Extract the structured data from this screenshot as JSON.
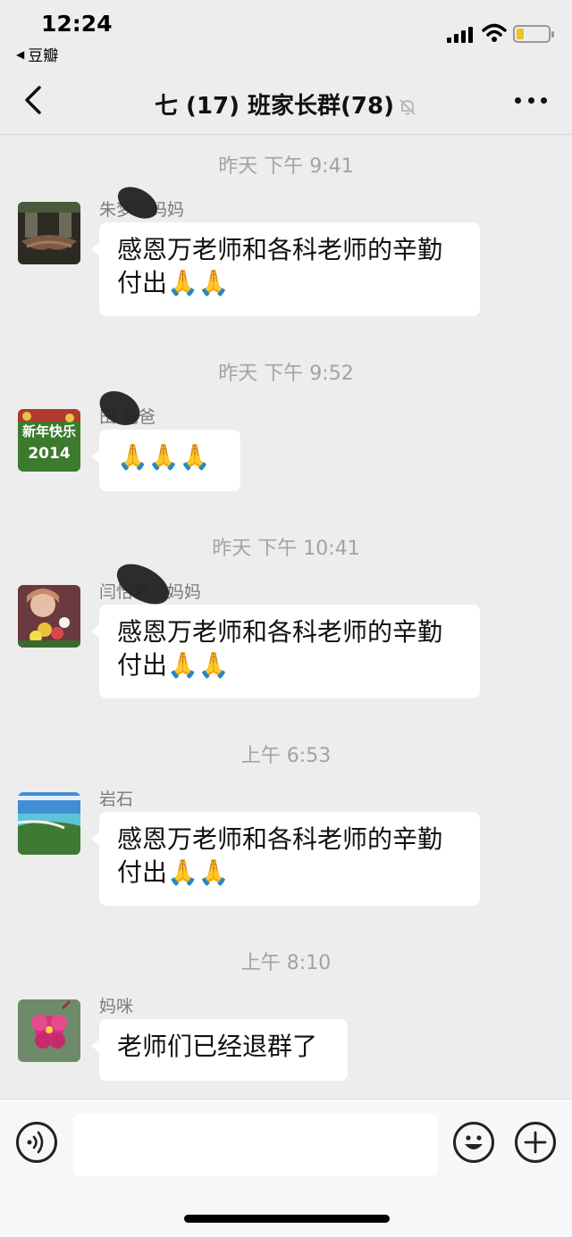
{
  "status_bar": {
    "time": "12:24",
    "back_app": "豆瓣"
  },
  "nav": {
    "title": "七 (17) 班家长群(78)",
    "icons": [
      "back-chevron-icon",
      "mute-bell-icon",
      "more-dots-icon"
    ]
  },
  "messages": [
    {
      "timestamp": "昨天 下午 9:41",
      "sender": "朱梦琪妈妈",
      "text": "感恩万老师和各科老师的辛勤付出🙏🙏"
    },
    {
      "timestamp": "昨天 下午 9:52",
      "sender": "田  爸爸",
      "text": "🙏🙏🙏",
      "avatar_text": "新年快乐2014"
    },
    {
      "timestamp": "昨天 下午 10:41",
      "sender": "闫怡君的妈妈",
      "text": "感恩万老师和各科老师的辛勤付出🙏🙏"
    },
    {
      "timestamp": "上午 6:53",
      "sender": "岩石",
      "text": "感恩万老师和各科老师的辛勤付出🙏🙏"
    },
    {
      "timestamp": "上午 8:10",
      "sender": "妈咪",
      "text": "老师们已经退群了"
    }
  ],
  "input_bar": {
    "icons": [
      "voice-icon",
      "emoji-icon",
      "plus-icon"
    ],
    "text": ""
  },
  "colors": {
    "background": "#ededed",
    "bubble": "#ffffff",
    "battery_fill": "#f0c419"
  }
}
